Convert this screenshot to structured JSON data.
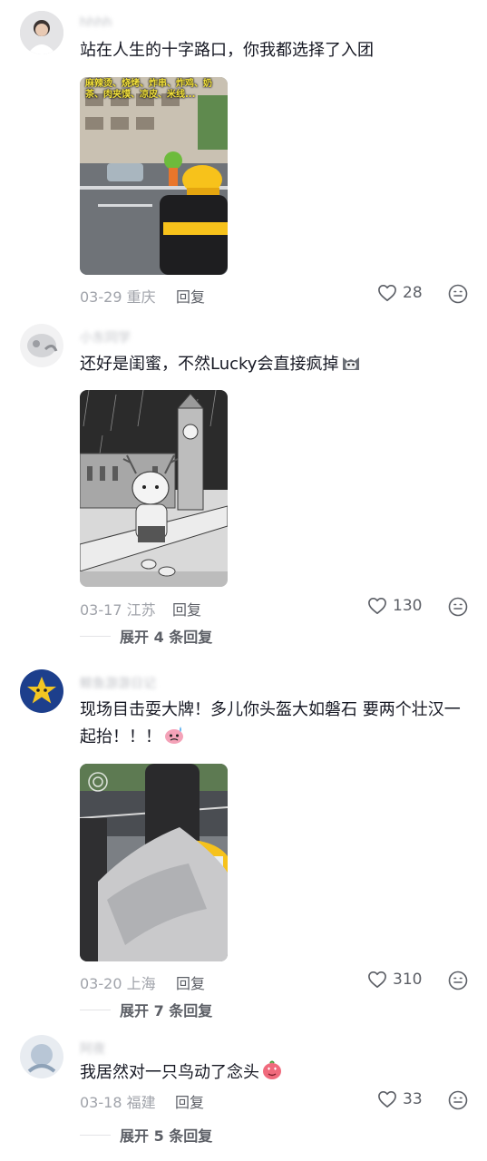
{
  "comments": [
    {
      "username": "hhhh",
      "text": "站在人生的十字路口，你我都选择了入团",
      "image_caption": "麻辣烫、烧烤、炸串、炸鸡、奶茶、肉夹馍、凉皮、米线...",
      "date": "03-29",
      "location": "重庆",
      "reply_label": "回复",
      "likes": "28"
    },
    {
      "username": "小东同学",
      "text": "还好是闺蜜，不然Lucky会直接疯掉",
      "date": "03-17",
      "location": "江苏",
      "reply_label": "回复",
      "likes": "130",
      "expand_label": "展开 4 条回复"
    },
    {
      "username": "鲸鱼游游日记",
      "text": "现场目击耍大牌！多儿你头盔大如磐石 要两个壮汉一起抬！！！",
      "date": "03-20",
      "location": "上海",
      "reply_label": "回复",
      "likes": "310",
      "expand_label": "展开 7 条回复"
    },
    {
      "username": "阿夜",
      "text": "我居然对一只鸟动了念头",
      "date": "03-18",
      "location": "福建",
      "reply_label": "回复",
      "likes": "33",
      "expand_label": "展开 5 条回复"
    }
  ],
  "icons": {
    "like": "heart-outline-icon",
    "react": "emoji-face-icon"
  },
  "colors": {
    "text": "#161823",
    "meta": "#a0a3aa",
    "action": "#5c5f66",
    "delivery_yellow": "#f7c21b"
  }
}
